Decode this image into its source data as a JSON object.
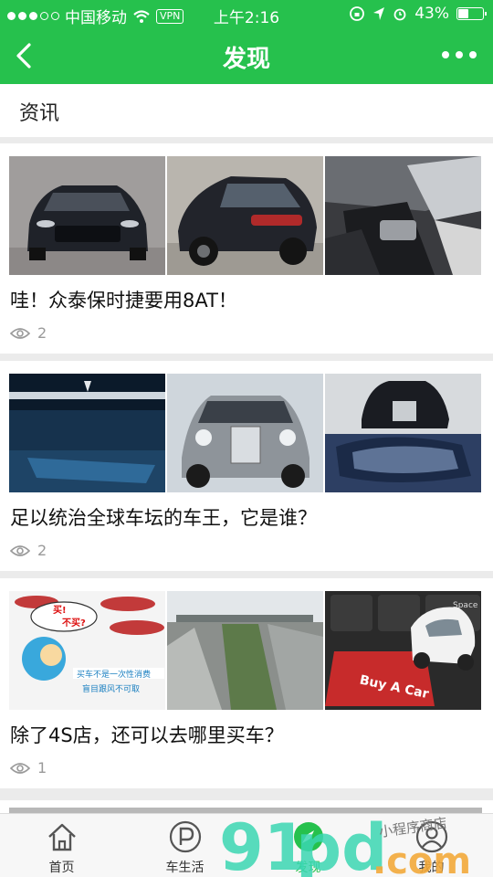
{
  "status_bar": {
    "carrier": "中国移动",
    "vpn": "VPN",
    "time": "上午2:16",
    "battery_level": 0.43,
    "battery_text": "43%"
  },
  "nav": {
    "title": "发现",
    "back_icon": "chevron-left-icon",
    "more_icon": "more-dots-icon"
  },
  "section": {
    "title": "资讯"
  },
  "articles": [
    {
      "title": "哇！众泰保时捷要用8AT！",
      "views": "2"
    },
    {
      "title": "足以统治全球车坛的车王，它是谁？",
      "views": "2"
    },
    {
      "title": "除了4S店，还可以去哪里买车？",
      "views": "1"
    }
  ],
  "thumb_texts": {
    "bubble_1": "买!",
    "bubble_2": "不买?",
    "banner_line1": "买车不是一次性消费",
    "banner_line2": "盲目跟风不可取",
    "key_label": "Buy A Car",
    "key_word": "Space"
  },
  "tabs": [
    {
      "label": "首页",
      "icon": "home-icon"
    },
    {
      "label": "车生活",
      "icon": "parking-icon"
    },
    {
      "label": "发现",
      "icon": "compass-icon"
    },
    {
      "label": "我的",
      "icon": "user-icon"
    }
  ],
  "watermark": {
    "text_small": "小程序商店",
    "text_big": ".com"
  },
  "colors": {
    "brand_green": "#26c14d"
  }
}
